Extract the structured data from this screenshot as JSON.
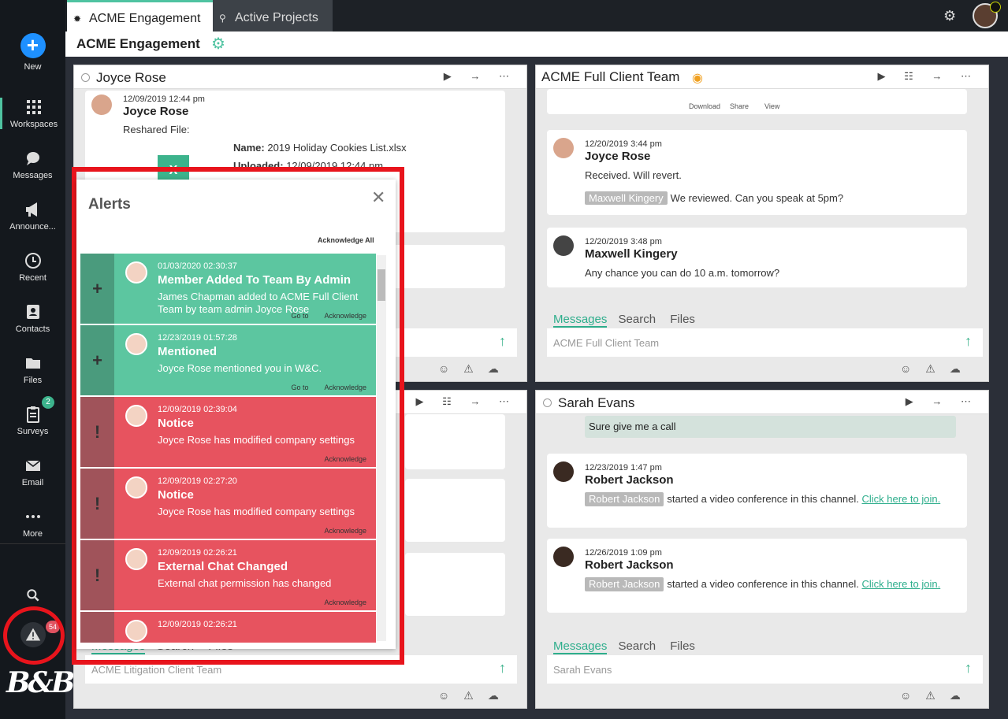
{
  "sidebar": {
    "new_label": "New",
    "items": [
      {
        "label": "Workspaces",
        "icon": "grid-icon"
      },
      {
        "label": "Messages",
        "icon": "chat-icon"
      },
      {
        "label": "Announce...",
        "icon": "megaphone-icon"
      },
      {
        "label": "Recent",
        "icon": "clock-icon"
      },
      {
        "label": "Contacts",
        "icon": "contacts-icon"
      },
      {
        "label": "Files",
        "icon": "folder-icon"
      },
      {
        "label": "Surveys",
        "icon": "clipboard-icon"
      },
      {
        "label": "Email",
        "icon": "envelope-icon"
      },
      {
        "label": "More",
        "icon": "dots-icon"
      }
    ],
    "surveys_badge": "2",
    "alerts_badge": "54",
    "logo_text": "B&B"
  },
  "tabs": [
    {
      "label": "ACME Engagement"
    },
    {
      "label": "Active Projects"
    }
  ],
  "header": {
    "title": "ACME Engagement"
  },
  "panels": {
    "joyce": {
      "title": "Joyce Rose",
      "msg_date": "12/09/2019 12:44 pm",
      "msg_name": "Joyce Rose",
      "msg_text": "Reshared File:",
      "file_name_label": "Name:",
      "file_name": "2019 Holiday Cookies List.xlsx",
      "file_uploaded_label": "Uploaded:",
      "file_uploaded": "12/09/2019 12:44 pm"
    },
    "acme_full": {
      "title": "ACME Full Client Team",
      "download": "Download",
      "share": "Share",
      "view": "View",
      "msg1_date": "12/20/2019 3:44 pm",
      "msg1_name": "Joyce Rose",
      "msg1_text": "Received. Will revert.",
      "msg1_tag": "Maxwell Kingery",
      "msg1_reply": "We reviewed. Can you speak at 5pm?",
      "msg2_date": "12/20/2019 3:48 pm",
      "msg2_name": "Maxwell Kingery",
      "msg2_text": "Any chance you can do 10 a.m. tomorrow?",
      "nav_messages": "Messages",
      "nav_search": "Search",
      "nav_files": "Files",
      "input_placeholder": "ACME Full Client Team"
    },
    "litigation": {
      "nav_messages": "Messages",
      "nav_search": "Search",
      "nav_files": "Files",
      "input_placeholder": "ACME Litigation Client Team"
    },
    "sarah": {
      "title": "Sarah Evans",
      "bubble": "Sure give me a call",
      "msg1_date": "12/23/2019 1:47 pm",
      "msg1_name": "Robert Jackson",
      "msg1_tag": "Robert Jackson",
      "msg1_text": "started a video conference in this channel.",
      "msg1_link": "Click here to join.",
      "msg2_date": "12/26/2019 1:09 pm",
      "msg2_name": "Robert Jackson",
      "msg2_tag": "Robert Jackson",
      "msg2_text": "started a video conference in this channel.",
      "msg2_link": "Click here to join.",
      "nav_messages": "Messages",
      "nav_search": "Search",
      "nav_files": "Files",
      "input_placeholder": "Sarah Evans"
    }
  },
  "alerts": {
    "title": "Alerts",
    "acknowledge_all": "Acknowledge All",
    "items": [
      {
        "type": "green",
        "date": "01/03/2020 02:30:37",
        "heading": "Member Added To Team By Admin",
        "body": "James Chapman added to ACME Full Client Team by team admin Joyce Rose",
        "goto": "Go to",
        "ack": "Acknowledge"
      },
      {
        "type": "green",
        "date": "12/23/2019 01:57:28",
        "heading": "Mentioned",
        "body": "Joyce Rose mentioned you in W&C.",
        "goto": "Go to",
        "ack": "Acknowledge"
      },
      {
        "type": "red",
        "date": "12/09/2019 02:39:04",
        "heading": "Notice",
        "body": "Joyce Rose has modified company settings",
        "ack": "Acknowledge"
      },
      {
        "type": "red",
        "date": "12/09/2019 02:27:20",
        "heading": "Notice",
        "body": "Joyce Rose has modified company settings",
        "ack": "Acknowledge"
      },
      {
        "type": "red",
        "date": "12/09/2019 02:26:21",
        "heading": "External Chat Changed",
        "body": "External chat permission has changed",
        "ack": "Acknowledge"
      },
      {
        "type": "red",
        "date": "12/09/2019 02:26:21",
        "heading": "",
        "body": "",
        "ack": ""
      }
    ]
  },
  "colors": {
    "accent": "#4fc3a1",
    "alert_green": "#5cc6a0",
    "alert_red": "#e7535f",
    "highlight": "#e8141c"
  }
}
